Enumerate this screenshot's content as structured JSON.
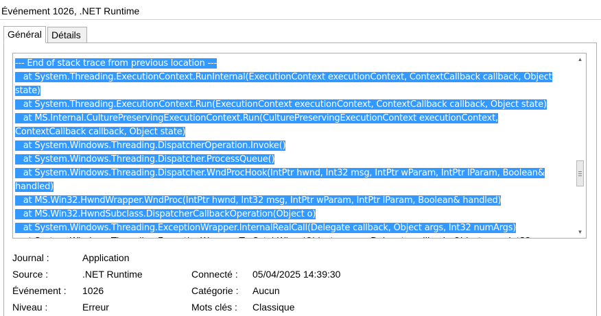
{
  "window": {
    "title": "Événement 1026, .NET Runtime"
  },
  "tabs": [
    {
      "label": "Général",
      "active": true
    },
    {
      "label": "Détails",
      "active": false
    }
  ],
  "event_text": {
    "lines": [
      "--- End of stack trace from previous location ---",
      "   at System.Threading.ExecutionContext.RunInternal(ExecutionContext executionContext, ContextCallback callback, Object",
      "state)",
      "   at System.Threading.ExecutionContext.Run(ExecutionContext executionContext, ContextCallback callback, Object state)",
      "   at MS.Internal.CulturePreservingExecutionContext.Run(CulturePreservingExecutionContext executionContext,",
      "ContextCallback callback, Object state)",
      "   at System.Windows.Threading.DispatcherOperation.Invoke()",
      "   at System.Windows.Threading.Dispatcher.ProcessQueue()",
      "   at System.Windows.Threading.Dispatcher.WndProcHook(IntPtr hwnd, Int32 msg, IntPtr wParam, IntPtr lParam, Boolean&",
      "handled)",
      "   at MS.Win32.HwndWrapper.WndProc(IntPtr hwnd, Int32 msg, IntPtr wParam, IntPtr lParam, Boolean& handled)",
      "   at MS.Win32.HwndSubclass.DispatcherCallbackOperation(Object o)",
      "   at System.Windows.Threading.ExceptionWrapper.InternalRealCall(Delegate callback, Object args, Int32 numArgs)",
      "   at System.Windows.Threading.ExceptionWrapper.TryCatchWhen(Object source, Delegate callback, Object args, Int32"
    ],
    "selected_line_count": 13
  },
  "properties": {
    "journal_label": "Journal :",
    "journal_value": "Application",
    "source_label": "Source :",
    "source_value": ".NET Runtime",
    "connecte_label": "Connecté :",
    "connecte_value": "05/04/2025 14:39:30",
    "evenement_label": "Événement :",
    "evenement_value": "1026",
    "categorie_label": "Catégorie :",
    "categorie_value": "Aucun",
    "niveau_label": "Niveau :",
    "niveau_value": "Erreur",
    "motscles_label": "Mots clés :",
    "motscles_value": "Classique"
  },
  "colors": {
    "selection": "#3399ff",
    "selection_text": "#ffffff"
  }
}
